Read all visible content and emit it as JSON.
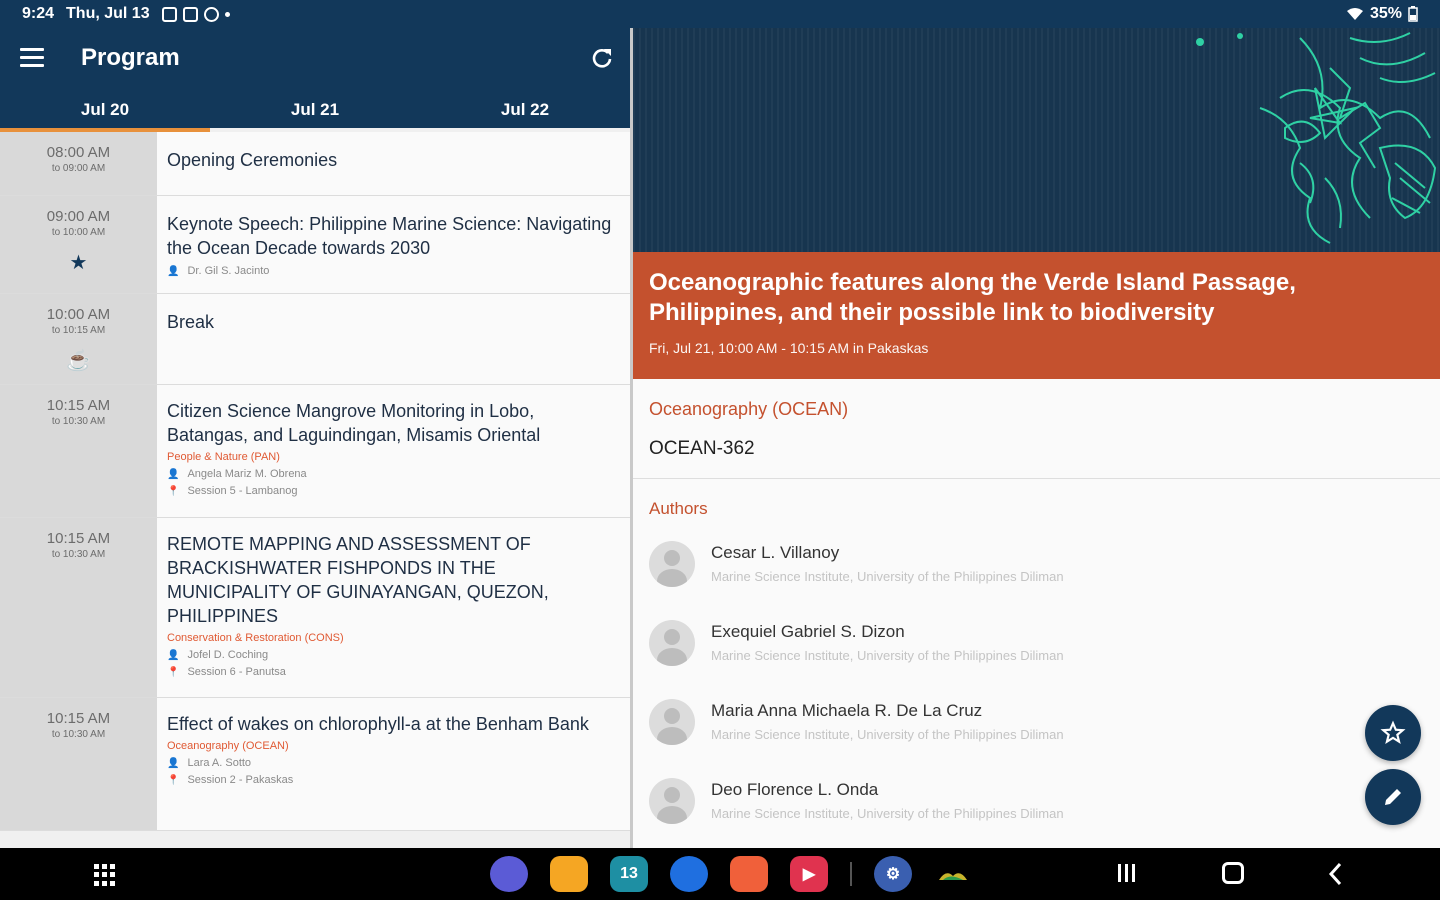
{
  "status": {
    "time": "9:24",
    "date": "Thu, Jul 13",
    "battery": "35%"
  },
  "appbar": {
    "title": "Program"
  },
  "tabs": [
    {
      "label": "Jul 20",
      "active": true
    },
    {
      "label": "Jul 21",
      "active": false
    },
    {
      "label": "Jul 22",
      "active": false
    }
  ],
  "sessions": [
    {
      "start": "08:00 AM",
      "end": "to 09:00 AM",
      "title": "Opening Ceremonies"
    },
    {
      "start": "09:00 AM",
      "end": "to 10:00 AM",
      "title": "Keynote Speech: Philippine Marine Science: Navigating the Ocean Decade towards 2030",
      "speaker": "Dr. Gil S. Jacinto",
      "icon": "star-icon"
    },
    {
      "start": "10:00 AM",
      "end": "to 10:15 AM",
      "title": "Break",
      "icon": "coffee-icon"
    },
    {
      "start": "10:15 AM",
      "end": "to 10:30 AM",
      "title": "Citizen Science Mangrove Monitoring in Lobo, Batangas, and Laguindingan, Misamis Oriental",
      "track": "People & Nature (PAN)",
      "speaker": "Angela Mariz M. Obrena",
      "room": "Session 5 - Lambanog"
    },
    {
      "start": "10:15 AM",
      "end": "to 10:30 AM",
      "title": "REMOTE MAPPING AND ASSESSMENT OF BRACKISHWATER FISHPONDS IN THE MUNICIPALITY OF GUINAYANGAN, QUEZON, PHILIPPINES",
      "track": "Conservation & Restoration (CONS)",
      "speaker": "Jofel D. Coching",
      "room": "Session 6 - Panutsa"
    },
    {
      "start": "10:15 AM",
      "end": "to 10:30 AM",
      "title": "Effect of wakes on chlorophyll-a at the Benham Bank",
      "track": "Oceanography (OCEAN)",
      "speaker": "Lara A. Sotto",
      "room": "Session 2 - Pakaskas"
    }
  ],
  "detail": {
    "title": "Oceanographic features along the Verde Island Passage, Philippines, and their possible link to biodiversity",
    "when": "Fri, Jul 21, 10:00 AM - 10:15 AM in Pakaskas",
    "category": "Oceanography (OCEAN)",
    "code": "OCEAN-362",
    "authors_heading": "Authors",
    "authors": [
      {
        "name": "Cesar L. Villanoy",
        "affiliation": "Marine Science Institute, University of the Philippines Diliman"
      },
      {
        "name": "Exequiel Gabriel S. Dizon",
        "affiliation": "Marine Science Institute, University of the Philippines Diliman"
      },
      {
        "name": "Maria Anna Michaela R. De La Cruz",
        "affiliation": "Marine Science Institute, University of the Philippines Diliman"
      },
      {
        "name": "Deo Florence L. Onda",
        "affiliation": "Marine Science Institute, University of the Philippines Diliman"
      }
    ]
  },
  "dock": [
    {
      "name": "internet-app-icon",
      "color": "#5b5bd6"
    },
    {
      "name": "files-app-icon",
      "color": "#f5a623"
    },
    {
      "name": "calendar-app-icon",
      "color": "#1e8fa3",
      "label": "13"
    },
    {
      "name": "messages-app-icon",
      "color": "#1f6fe0"
    },
    {
      "name": "contacts-app-icon",
      "color": "#f0603a"
    },
    {
      "name": "youtube-app-icon",
      "color": "#e0334f"
    },
    {
      "name": "settings-app-icon",
      "color": "#3a5fb0"
    },
    {
      "name": "conference-app-icon",
      "color": "#000000"
    }
  ]
}
